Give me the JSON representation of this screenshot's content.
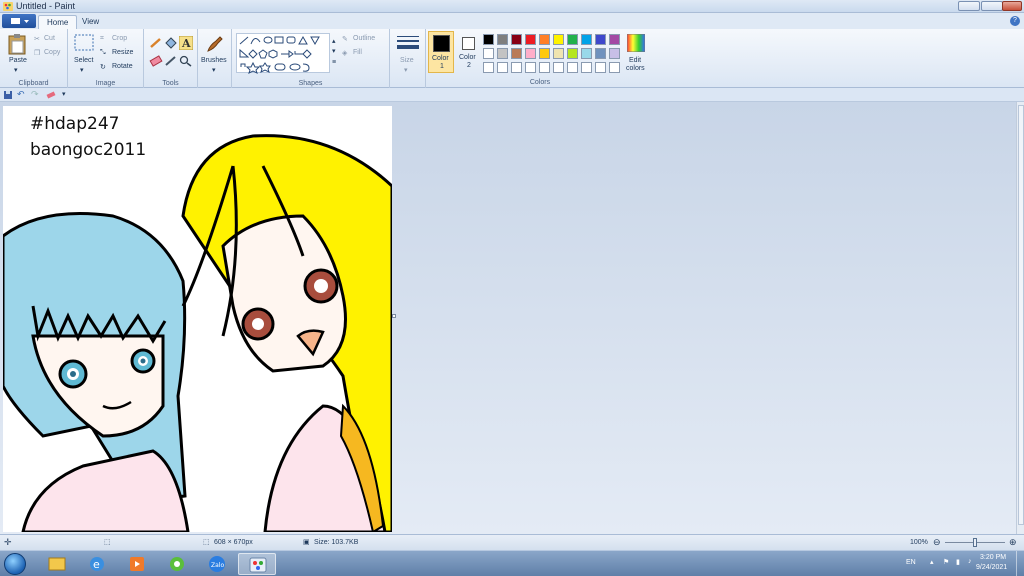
{
  "window": {
    "title": "Untitled - Paint"
  },
  "tabs": [
    {
      "label": "Home"
    },
    {
      "label": "View"
    }
  ],
  "ribbon": {
    "clipboard": {
      "label": "Clipboard",
      "paste": "Paste",
      "cut": "Cut",
      "copy": "Copy"
    },
    "image": {
      "label": "Image",
      "select": "Select",
      "crop": "Crop",
      "resize": "Resize",
      "rotate": "Rotate"
    },
    "tools": {
      "label": "Tools"
    },
    "brushes": {
      "label": "Brushes"
    },
    "shapes": {
      "label": "Shapes",
      "outline": "Outline",
      "fill": "Fill"
    },
    "size": {
      "label": "Size"
    },
    "colors": {
      "label": "Colors",
      "color1_label": "Color",
      "color1_num": "1",
      "color2_label": "Color",
      "color2_num": "2",
      "edit_label": "Edit",
      "edit_label2": "colors",
      "color1_value": "#000000",
      "color2_value": "#ffffff",
      "palette_row1": [
        "#000000",
        "#7f7f7f",
        "#880015",
        "#ed1c24",
        "#ff7f27",
        "#fff200",
        "#22b14c",
        "#00a2e8",
        "#3f48cc",
        "#a349a4"
      ],
      "palette_row2": [
        "#ffffff",
        "#c3c3c3",
        "#b97a57",
        "#ffaec9",
        "#ffc90e",
        "#efe4b0",
        "#b5e61d",
        "#99d9ea",
        "#7092be",
        "#c8bfe7"
      ],
      "palette_row3": [
        "#ffffff",
        "#ffffff",
        "#ffffff",
        "#ffffff",
        "#ffffff",
        "#ffffff",
        "#ffffff",
        "#ffffff",
        "#ffffff",
        "#ffffff"
      ]
    }
  },
  "canvas": {
    "line1": "#hdap247",
    "line2": "baongoc2011"
  },
  "status": {
    "dimensions": "608 × 670px",
    "size": "Size: 103.7KB",
    "zoom": "100%"
  },
  "taskbar": {
    "lang": "EN",
    "time": "3:20 PM",
    "date": "9/24/2021"
  }
}
